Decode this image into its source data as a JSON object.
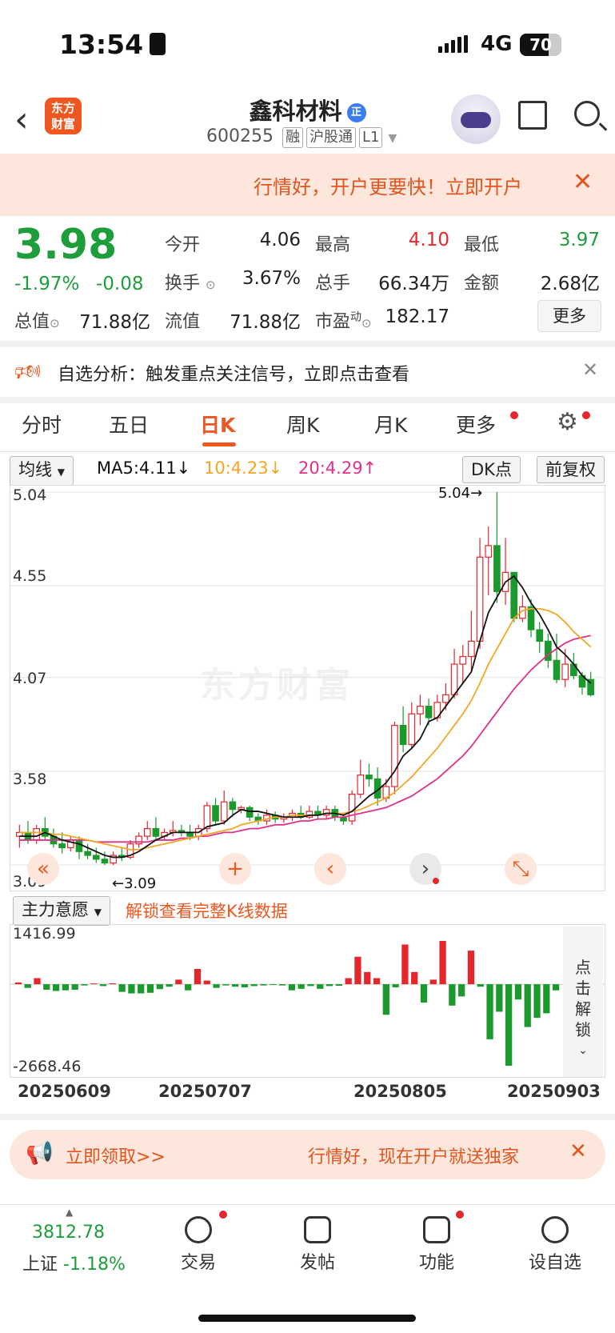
{
  "status_bar": {
    "time": "13:54",
    "network": "4G",
    "battery": "70"
  },
  "header": {
    "logo_text": "东方财富",
    "stock_name": "鑫科材料",
    "badge": "正",
    "code": "600255",
    "tags": [
      "融",
      "沪股通",
      "L1"
    ]
  },
  "banner_top": {
    "text": "行情好，开户更要快！立即开户",
    "close": "✕"
  },
  "quote": {
    "price": "3.98",
    "change_pct": "-1.97%",
    "change": "-0.08",
    "open_label": "今开",
    "open": "4.06",
    "high_label": "最高",
    "high": "4.10",
    "low_label": "最低",
    "low": "3.97",
    "turnover_label": "换手",
    "turnover": "3.67%",
    "volume_label": "总手",
    "volume": "66.34万",
    "amount_label": "金额",
    "amount": "2.68亿",
    "mcap_label": "总值",
    "mcap": "71.88亿",
    "float_label": "流值",
    "float": "71.88亿",
    "pe_label": "市盈",
    "pe_sup": "动",
    "pe": "182.17",
    "more_button": "更多"
  },
  "analysis": {
    "text": "自选分析：触发重点关注信号，立即点击查看",
    "close": "✕"
  },
  "tabs": [
    "分时",
    "五日",
    "日K",
    "周K",
    "月K",
    "更多"
  ],
  "active_tab": "日K",
  "ma_bar": {
    "select": "均线",
    "ma5": "MA5:4.11↓",
    "ma10": "10:4.23↓",
    "ma20": "20:4.29↑",
    "dk": "DK点",
    "adjust": "前复权"
  },
  "chart_data": {
    "type": "candlestick",
    "y_ticks": [
      "5.04",
      "4.55",
      "4.07",
      "3.58",
      "3.09"
    ],
    "ylim": [
      3.09,
      5.04
    ],
    "max_label": "5.04→",
    "min_label": "←3.09",
    "watermark": "东方财富",
    "x_dates": [
      "20250609",
      "20250707",
      "20250805",
      "20250903"
    ],
    "candles": [
      [
        3.24,
        3.26,
        3.3,
        3.18
      ],
      [
        3.26,
        3.22,
        3.32,
        3.2
      ],
      [
        3.22,
        3.28,
        3.3,
        3.2
      ],
      [
        3.28,
        3.24,
        3.34,
        3.22
      ],
      [
        3.24,
        3.2,
        3.28,
        3.18
      ],
      [
        3.2,
        3.18,
        3.26,
        3.15
      ],
      [
        3.18,
        3.22,
        3.24,
        3.16
      ],
      [
        3.22,
        3.16,
        3.24,
        3.12
      ],
      [
        3.16,
        3.14,
        3.2,
        3.12
      ],
      [
        3.14,
        3.12,
        3.18,
        3.1
      ],
      [
        3.12,
        3.1,
        3.16,
        3.09
      ],
      [
        3.1,
        3.14,
        3.16,
        3.09
      ],
      [
        3.14,
        3.13,
        3.18,
        3.11
      ],
      [
        3.13,
        3.2,
        3.22,
        3.12
      ],
      [
        3.2,
        3.24,
        3.26,
        3.18
      ],
      [
        3.24,
        3.28,
        3.32,
        3.22
      ],
      [
        3.28,
        3.24,
        3.34,
        3.22
      ],
      [
        3.24,
        3.26,
        3.28,
        3.22
      ],
      [
        3.26,
        3.27,
        3.32,
        3.24
      ],
      [
        3.27,
        3.26,
        3.3,
        3.24
      ],
      [
        3.26,
        3.24,
        3.3,
        3.22
      ],
      [
        3.24,
        3.28,
        3.3,
        3.22
      ],
      [
        3.28,
        3.4,
        3.42,
        3.26
      ],
      [
        3.4,
        3.32,
        3.44,
        3.3
      ],
      [
        3.32,
        3.42,
        3.48,
        3.3
      ],
      [
        3.42,
        3.38,
        3.44,
        3.34
      ],
      [
        3.38,
        3.39,
        3.4,
        3.36
      ],
      [
        3.39,
        3.34,
        3.4,
        3.32
      ],
      [
        3.34,
        3.32,
        3.36,
        3.3
      ],
      [
        3.32,
        3.35,
        3.38,
        3.3
      ],
      [
        3.35,
        3.33,
        3.37,
        3.31
      ],
      [
        3.33,
        3.34,
        3.36,
        3.31
      ],
      [
        3.34,
        3.36,
        3.38,
        3.32
      ],
      [
        3.36,
        3.34,
        3.4,
        3.33
      ],
      [
        3.34,
        3.37,
        3.4,
        3.33
      ],
      [
        3.37,
        3.35,
        3.4,
        3.33
      ],
      [
        3.35,
        3.38,
        3.4,
        3.33
      ],
      [
        3.38,
        3.34,
        3.4,
        3.32
      ],
      [
        3.34,
        3.32,
        3.36,
        3.3
      ],
      [
        3.32,
        3.46,
        3.48,
        3.3
      ],
      [
        3.46,
        3.56,
        3.64,
        3.44
      ],
      [
        3.56,
        3.54,
        3.62,
        3.5
      ],
      [
        3.54,
        3.44,
        3.6,
        3.4
      ],
      [
        3.44,
        3.5,
        3.54,
        3.42
      ],
      [
        3.5,
        3.82,
        3.84,
        3.46
      ],
      [
        3.82,
        3.72,
        3.92,
        3.68
      ],
      [
        3.72,
        3.88,
        3.94,
        3.7
      ],
      [
        3.88,
        3.92,
        3.98,
        3.82
      ],
      [
        3.92,
        3.86,
        3.96,
        3.82
      ],
      [
        3.86,
        3.94,
        3.98,
        3.84
      ],
      [
        3.94,
        3.98,
        4.04,
        3.9
      ],
      [
        3.98,
        4.14,
        4.22,
        3.96
      ],
      [
        4.14,
        4.18,
        4.24,
        4.04
      ],
      [
        4.18,
        4.26,
        4.42,
        4.1
      ],
      [
        4.26,
        4.7,
        4.8,
        4.22
      ],
      [
        4.7,
        4.76,
        4.86,
        4.5
      ],
      [
        4.76,
        4.52,
        5.04,
        4.46
      ],
      [
        4.52,
        4.62,
        4.8,
        4.45
      ],
      [
        4.62,
        4.38,
        4.62,
        4.36
      ],
      [
        4.38,
        4.44,
        4.5,
        4.36
      ],
      [
        4.44,
        4.32,
        4.48,
        4.28
      ],
      [
        4.32,
        4.26,
        4.36,
        4.2
      ],
      [
        4.26,
        4.16,
        4.3,
        4.12
      ],
      [
        4.16,
        4.06,
        4.3,
        4.04
      ],
      [
        4.06,
        4.14,
        4.22,
        4.02
      ],
      [
        4.14,
        4.08,
        4.2,
        4.06
      ],
      [
        4.08,
        4.02,
        4.1,
        3.98
      ],
      [
        4.06,
        3.98,
        4.1,
        3.97
      ]
    ],
    "ma5": [
      3.24,
      3.24,
      3.24,
      3.26,
      3.24,
      3.22,
      3.21,
      3.2,
      3.18,
      3.16,
      3.14,
      3.13,
      3.13,
      3.14,
      3.16,
      3.19,
      3.22,
      3.24,
      3.26,
      3.26,
      3.26,
      3.26,
      3.29,
      3.3,
      3.31,
      3.35,
      3.38,
      3.37,
      3.37,
      3.36,
      3.35,
      3.34,
      3.34,
      3.34,
      3.35,
      3.35,
      3.36,
      3.36,
      3.35,
      3.37,
      3.41,
      3.45,
      3.48,
      3.52,
      3.58,
      3.66,
      3.7,
      3.75,
      3.84,
      3.86,
      3.92,
      3.98,
      4.04,
      4.1,
      4.26,
      4.41,
      4.49,
      4.57,
      4.6,
      4.54,
      4.46,
      4.4,
      4.32,
      4.23,
      4.19,
      4.14,
      4.08,
      4.04
    ],
    "ma10": [
      3.26,
      3.26,
      3.26,
      3.26,
      3.25,
      3.25,
      3.24,
      3.23,
      3.22,
      3.21,
      3.2,
      3.19,
      3.18,
      3.17,
      3.17,
      3.18,
      3.19,
      3.2,
      3.21,
      3.22,
      3.23,
      3.24,
      3.25,
      3.26,
      3.27,
      3.28,
      3.3,
      3.31,
      3.32,
      3.33,
      3.34,
      3.34,
      3.35,
      3.35,
      3.35,
      3.35,
      3.36,
      3.36,
      3.36,
      3.37,
      3.38,
      3.4,
      3.42,
      3.44,
      3.47,
      3.51,
      3.55,
      3.6,
      3.65,
      3.7,
      3.76,
      3.82,
      3.88,
      3.95,
      4.04,
      4.14,
      4.22,
      4.3,
      4.38,
      4.42,
      4.43,
      4.43,
      4.42,
      4.4,
      4.36,
      4.31,
      4.27,
      4.23
    ],
    "ma20": [
      3.22,
      3.22,
      3.22,
      3.22,
      3.22,
      3.22,
      3.22,
      3.22,
      3.22,
      3.21,
      3.21,
      3.21,
      3.21,
      3.21,
      3.21,
      3.21,
      3.22,
      3.22,
      3.22,
      3.23,
      3.23,
      3.24,
      3.24,
      3.25,
      3.26,
      3.26,
      3.27,
      3.28,
      3.28,
      3.29,
      3.3,
      3.3,
      3.31,
      3.32,
      3.32,
      3.33,
      3.33,
      3.34,
      3.34,
      3.35,
      3.36,
      3.37,
      3.38,
      3.39,
      3.41,
      3.43,
      3.45,
      3.48,
      3.51,
      3.54,
      3.58,
      3.62,
      3.66,
      3.71,
      3.77,
      3.83,
      3.89,
      3.95,
      4.01,
      4.06,
      4.11,
      4.15,
      4.19,
      4.22,
      4.25,
      4.27,
      4.28,
      4.29
    ],
    "ma_colors": {
      "ma5": "#111111",
      "ma10": "#f5a623",
      "ma20": "#e0308a"
    }
  },
  "indicator": {
    "select": "主力意愿",
    "note": "解锁查看完整K线数据",
    "max": "1416.99",
    "min": "-2668.46",
    "unlock": [
      "点",
      "击",
      "解",
      "锁"
    ],
    "bars": [
      60,
      -120,
      200,
      -180,
      -220,
      -200,
      -180,
      -40,
      20,
      -60,
      30,
      -250,
      -300,
      -300,
      -280,
      -160,
      -80,
      150,
      -200,
      500,
      120,
      -120,
      -40,
      -80,
      -100,
      -60,
      -40,
      -20,
      -40,
      -200,
      -150,
      -60,
      -150,
      -60,
      -50,
      200,
      900,
      400,
      200,
      -1000,
      -100,
      1300,
      400,
      -600,
      150,
      1416,
      -700,
      -400,
      1100,
      -80,
      -1800,
      -900,
      -2668,
      -500,
      -1400,
      -1100,
      -950,
      -200
    ],
    "colors": {
      "up": "#e5262b",
      "down": "#1a9a2c"
    }
  },
  "controls": [
    "«",
    "+",
    "‹",
    "›",
    "⤡"
  ],
  "banner_bottom": {
    "cta": "立即领取>>",
    "text": "行情好，现在开户就送独家",
    "close": "✕"
  },
  "bottom_nav": {
    "index_value": "3812.78",
    "index_name": "上证",
    "index_change": "-1.18%",
    "items": [
      "交易",
      "发帖",
      "功能",
      "设自选"
    ]
  }
}
